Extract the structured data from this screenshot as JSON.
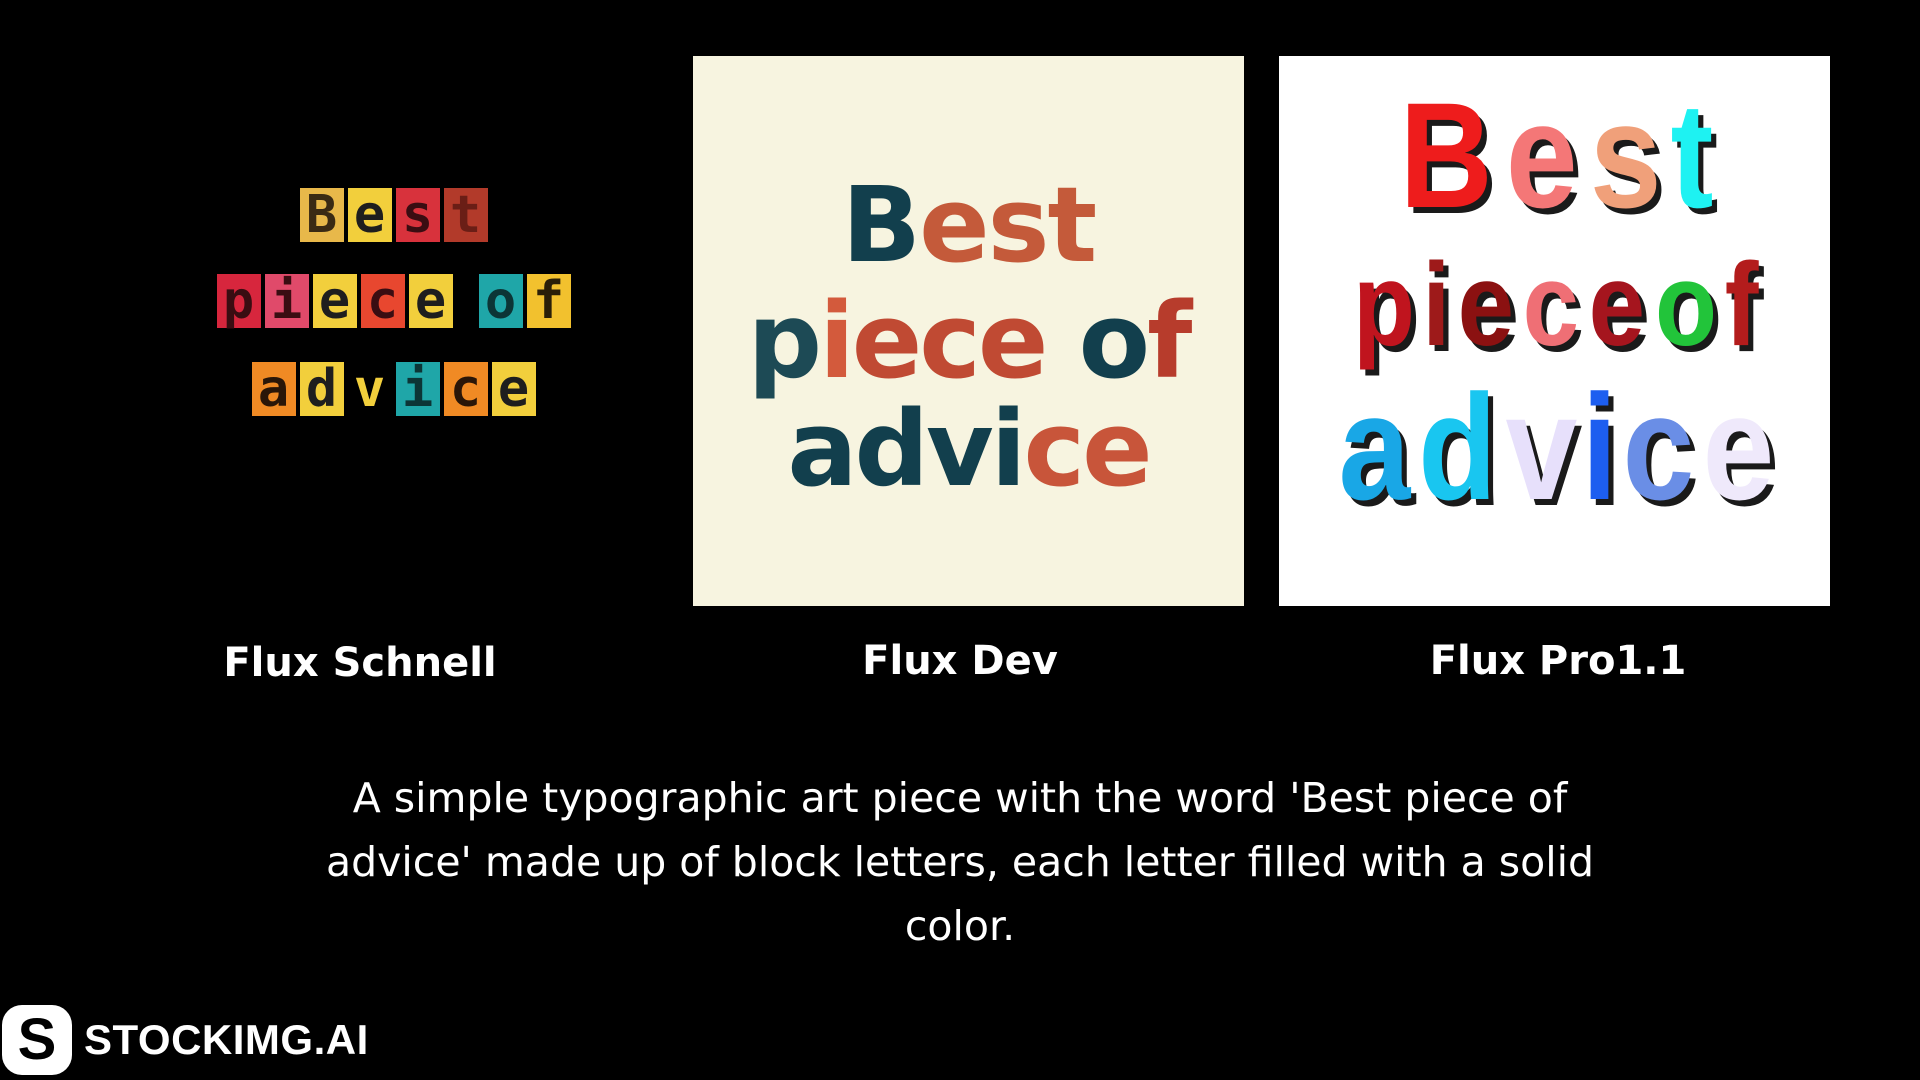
{
  "panels": [
    {
      "caption": "Flux Schnell",
      "lines": [
        [
          {
            "ch": "B",
            "bg": "#e8b84a",
            "fg": "#3a2a14"
          },
          {
            "ch": "e",
            "bg": "#f2cf3c",
            "fg": "#1e1e1e"
          },
          {
            "ch": "s",
            "bg": "#d8323c",
            "fg": "#3a0d12"
          },
          {
            "ch": "t",
            "bg": "#b23a2a",
            "fg": "#6a1e16"
          }
        ],
        [
          {
            "ch": "p",
            "bg": "#d7263d",
            "fg": "#3a0d12"
          },
          {
            "ch": "i",
            "bg": "#e04a6a",
            "fg": "#3a0d12"
          },
          {
            "ch": "e",
            "bg": "#f2cf3c",
            "fg": "#1e1e1e"
          },
          {
            "ch": "c",
            "bg": "#e8472f",
            "fg": "#3a0d12"
          },
          {
            "ch": "e",
            "bg": "#f2cf3c",
            "fg": "#1e1e1e"
          },
          {
            "ch": " ",
            "bg": "transparent",
            "fg": "#000000"
          },
          {
            "ch": "o",
            "bg": "#1fa6a8",
            "fg": "#0c3536"
          },
          {
            "ch": "f",
            "bg": "#f2c12e",
            "fg": "#2a1f08"
          }
        ],
        [
          {
            "ch": "a",
            "bg": "#f08a24",
            "fg": "#2a1608"
          },
          {
            "ch": "d",
            "bg": "#f2cf3c",
            "fg": "#1e1e1e"
          },
          {
            "ch": "v",
            "bg": "#000000",
            "fg": "#f2cf3c"
          },
          {
            "ch": "i",
            "bg": "#1fa6a8",
            "fg": "#0c3536"
          },
          {
            "ch": "c",
            "bg": "#f08a24",
            "fg": "#2a1608"
          },
          {
            "ch": "e",
            "bg": "#f2cf3c",
            "fg": "#1e1e1e"
          }
        ]
      ]
    },
    {
      "caption": "Flux Dev",
      "lines": [
        [
          {
            "t": "B",
            "c": "#123f4d"
          },
          {
            "t": "est",
            "c": "#c45a3a"
          }
        ],
        [
          {
            "t": "p",
            "c": "#1d4a55"
          },
          {
            "t": "i",
            "c": "#d35a3c"
          },
          {
            "t": "ece ",
            "c": "#c04a33"
          },
          {
            "t": "o",
            "c": "#123f4d"
          },
          {
            "t": "f",
            "c": "#b73c2c"
          }
        ],
        [
          {
            "t": "advi",
            "c": "#123f4d"
          },
          {
            "t": "ce",
            "c": "#c8553a"
          }
        ]
      ]
    },
    {
      "caption": "Flux Pro1.1",
      "lines": [
        [
          {
            "t": "B",
            "c": "#ee1c1c"
          },
          {
            "t": "e",
            "c": "#f47777"
          },
          {
            "t": "s",
            "c": "#f0a07a"
          },
          {
            "t": "t",
            "c": "#1ef2f2"
          }
        ],
        [
          {
            "t": "p",
            "c": "#c0141e"
          },
          {
            "t": "i",
            "c": "#9e1a1a"
          },
          {
            "t": "e",
            "c": "#8b1111"
          },
          {
            "t": "c",
            "c": "#ef6f75"
          },
          {
            "t": "e",
            "c": "#a5151e"
          },
          {
            "t": " ",
            "c": "#ffffff"
          },
          {
            "t": "o",
            "c": "#22c43a"
          },
          {
            "t": "f",
            "c": "#b31c1c"
          }
        ],
        [
          {
            "t": "a",
            "c": "#19a7e6"
          },
          {
            "t": "d",
            "c": "#19c6f0"
          },
          {
            "t": "v",
            "c": "#e7e0fb"
          },
          {
            "t": "i",
            "c": "#1d5ef0"
          },
          {
            "t": "c",
            "c": "#6a8ee6"
          },
          {
            "t": "e",
            "c": "#efe9fb"
          }
        ]
      ]
    }
  ],
  "description": "A simple typographic art piece with the word 'Best piece of advice' made up of block letters, each letter filled with a solid color.",
  "brand": {
    "mark": "S",
    "name": "STOCKIMG.AI"
  }
}
